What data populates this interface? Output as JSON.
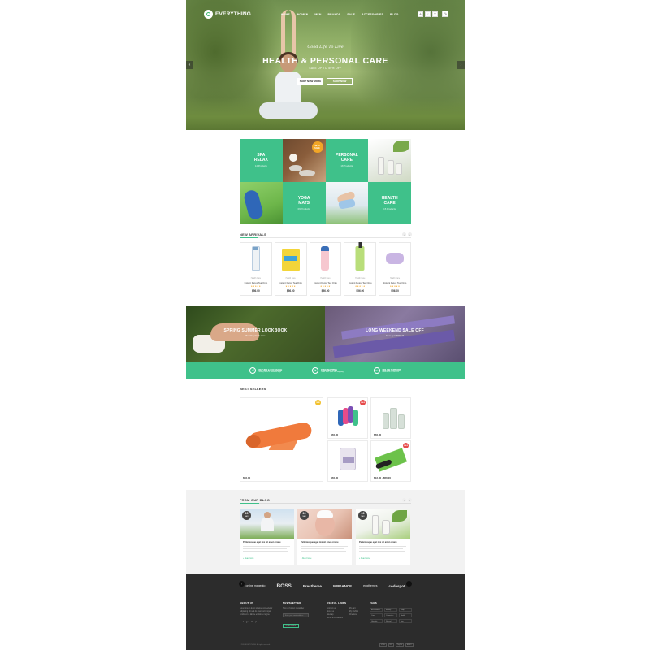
{
  "header": {
    "logo": "EVERYTHING",
    "menu": [
      "HOME",
      "WOMEN",
      "MEN",
      "BRANDS",
      "SALE",
      "ACCESSORIES",
      "BLOG"
    ],
    "icons": [
      "user-icon",
      "heart-icon",
      "search-icon",
      "cart-icon"
    ],
    "icon_labels": [
      "♙",
      "♡",
      "⚲",
      "♙"
    ]
  },
  "hero": {
    "subtitle": "Good Life To Live",
    "title": "HEALTH & PERSONAL CARE",
    "tagline": "SALE UP TO 50% OFF",
    "btn_primary": "SHOP NOW MORE",
    "btn_secondary": "SHOP NOW",
    "arrow_left": "‹",
    "arrow_right": "›"
  },
  "categories": [
    {
      "title_1": "SPA",
      "title_2": "RELAX",
      "count": "12 Products"
    },
    {
      "title_1": "PERSONAL",
      "title_2": "CARE",
      "count": "18 Products"
    },
    {
      "title_1": "YOGA",
      "title_2": "MATS",
      "count": "09 Products"
    },
    {
      "title_1": "HEALTH",
      "title_2": "CARE",
      "count": "15 Products"
    }
  ],
  "sale_badge": {
    "line1": "$9.00",
    "line2": "SALE"
  },
  "new_arrivals": {
    "heading": "NEW ARRIVALS",
    "products": [
      {
        "category": "Health Care",
        "name": "Instant Detox Tea Onto",
        "stars": "★★★★★",
        "price": "$56.00"
      },
      {
        "category": "Health Care",
        "name": "Instant Detox Tea Onto",
        "stars": "★★★★★",
        "price": "$56.00"
      },
      {
        "category": "Health Care",
        "name": "Instant Detox Tea Onto",
        "stars": "★★★★★",
        "price": "$56.00"
      },
      {
        "category": "Health Care",
        "name": "Instant Detox Tea Onto",
        "stars": "★★★★★",
        "price": "$56.00"
      },
      {
        "category": "Health Care",
        "name": "Instant Detox Tea Onto",
        "stars": "★★★★★",
        "price": "$56.00"
      }
    ]
  },
  "promos": [
    {
      "title": "SPRING SUMMER LOOKBOOK",
      "subtitle": "Best Day Deals Here"
    },
    {
      "title": "LONG WEEKEND SALE OFF",
      "subtitle": "Save up to 50% off"
    }
  ],
  "features": [
    {
      "icon": "↺",
      "title": "RETURN & EXCHANGE",
      "sub": "Simply return it within 30 days"
    },
    {
      "icon": "✈",
      "title": "FREE SHIPPING",
      "sub": "Order over $100 free shipping"
    },
    {
      "icon": "☏",
      "title": "ONLINE SUPPORT",
      "sub": "Hotline: 0123 456 789"
    }
  ],
  "best_sellers": {
    "heading": "BEST SELLERS",
    "items": [
      {
        "price": "$56.00",
        "badge": "NEW"
      },
      {
        "price": "$56.00",
        "badge": "SALE"
      },
      {
        "price": "$56.00",
        "badge": ""
      },
      {
        "price": "$56.00",
        "badge": ""
      },
      {
        "price": "$12.00 - $56.00",
        "badge": "SALE"
      }
    ]
  },
  "blog": {
    "heading": "FROM OUR BLOG",
    "posts": [
      {
        "day": "26",
        "month": "MAR",
        "title": "Pellentesque eget nisi sit amet ornare",
        "more": "+ Read more"
      },
      {
        "day": "26",
        "month": "MAR",
        "title": "Pellentesque eget nisi sit amet ornare",
        "more": "+ Read more"
      },
      {
        "day": "26",
        "month": "MAR",
        "title": "Pellentesque eget nisi sit amet ornare",
        "more": "+ Read more"
      }
    ]
  },
  "footer": {
    "brands": [
      "online magento",
      "BOSS",
      "Prestheme",
      "WPDANCE",
      "eggthemes",
      "codespot"
    ],
    "brand_sub": "DESIGN",
    "about": {
      "heading": "ABOUT US",
      "text": [
        "Lorem ipsum dolor sit amet consectetur",
        "adipiscing elit sed do eiusmod tempor",
        "incididunt ut labore et dolore magna"
      ],
      "social": [
        "f",
        "t",
        "g+",
        "in",
        "p"
      ]
    },
    "newsletter": {
      "heading": "NEWSLETTER",
      "text": "Sign up for our newsletter",
      "placeholder": "Enter your email address",
      "button": "SUBSCRIBE"
    },
    "links": {
      "heading": "USEFUL LINKS",
      "col1": [
        "Contact us",
        "About us",
        "Sitemap",
        "Terms & Conditions"
      ],
      "col2": [
        "My cart",
        "My wishlist",
        "Checkout"
      ]
    },
    "tags": {
      "heading": "TAGS",
      "items": [
        "Accessories",
        "Beauty",
        "Body",
        "Care",
        "Cosmetics",
        "Health",
        "Lifestyle",
        "Natural",
        "Spa"
      ]
    },
    "copyright": "© 2016 EVERYTHING. All rights reserved.",
    "payments": [
      "VISA",
      "MC",
      "PayPal",
      "AMEX"
    ]
  }
}
